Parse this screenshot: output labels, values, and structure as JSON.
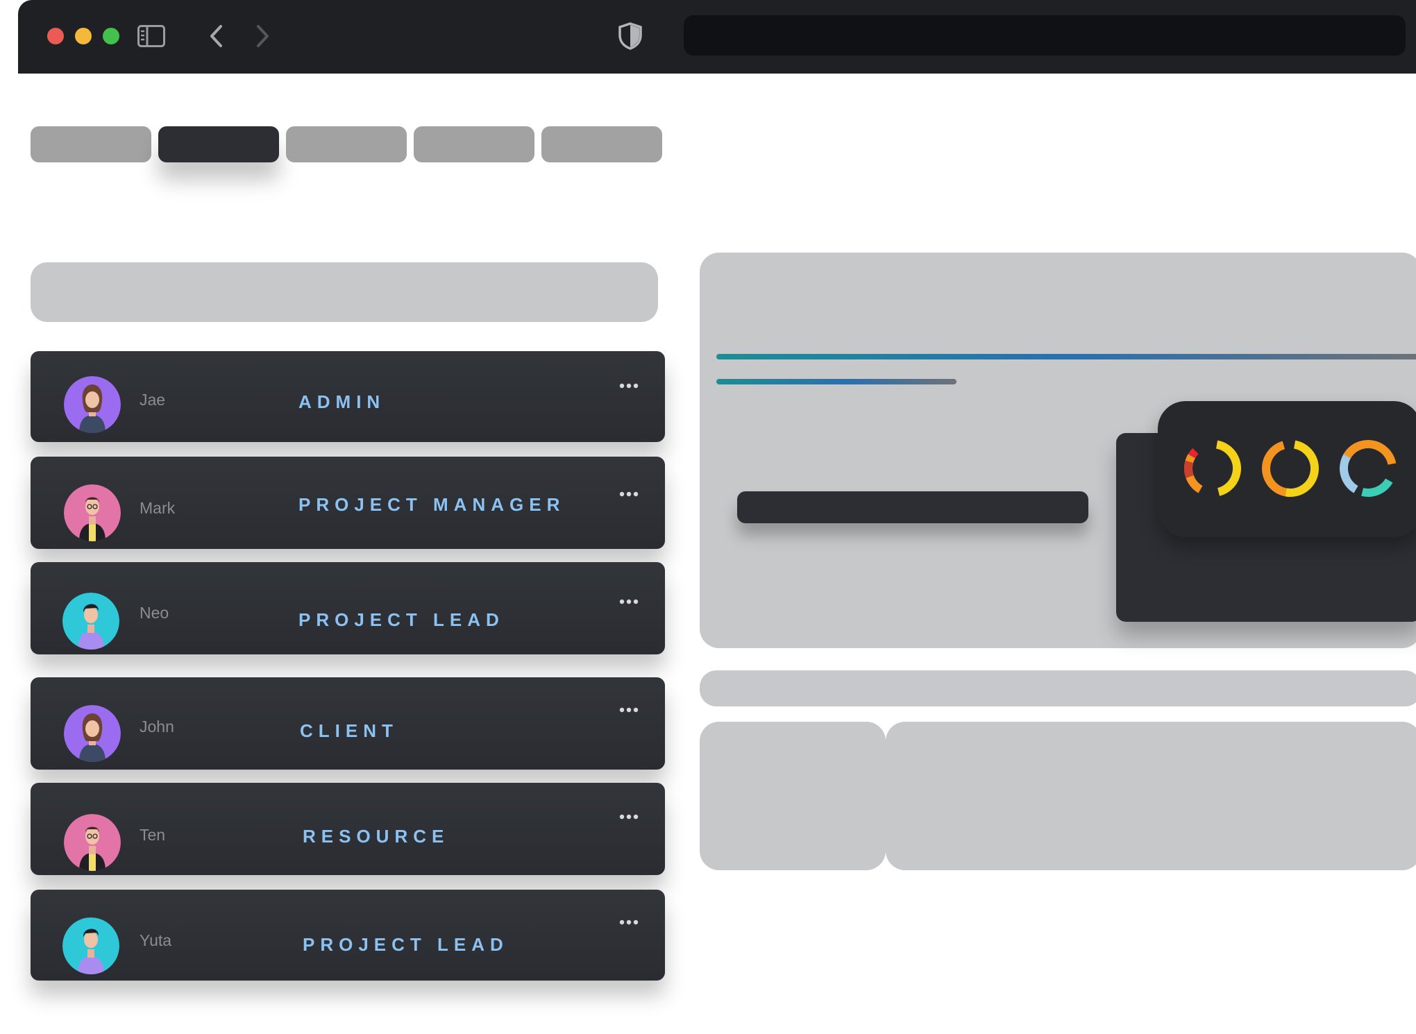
{
  "members": [
    {
      "name": "Jae",
      "role": "ADMIN",
      "avatar": "woman-avatar",
      "avatar_bg": "#9b6cf0"
    },
    {
      "name": "Mark",
      "role": "PROJECT MANAGER",
      "avatar": "man-glasses-avatar",
      "avatar_bg": "#e374a8"
    },
    {
      "name": "Neo",
      "role": "PROJECT LEAD",
      "avatar": "man-avatar",
      "avatar_bg": "#2ec8d8"
    },
    {
      "name": "John",
      "role": "CLIENT",
      "avatar": "woman-avatar",
      "avatar_bg": "#9b6cf0"
    },
    {
      "name": "Ten",
      "role": "RESOURCE",
      "avatar": "man-glasses-avatar",
      "avatar_bg": "#e374a8"
    },
    {
      "name": "Yuta",
      "role": "PROJECT LEAD",
      "avatar": "man-avatar",
      "avatar_bg": "#2ec8d8"
    }
  ],
  "colors": {
    "chrome_bg": "#1f2023",
    "role_text": "#8cc2f2",
    "card_dark": "#2c2e33",
    "placeholder_gray": "#c7c8ca",
    "tab_gray": "#a2a2a2"
  }
}
